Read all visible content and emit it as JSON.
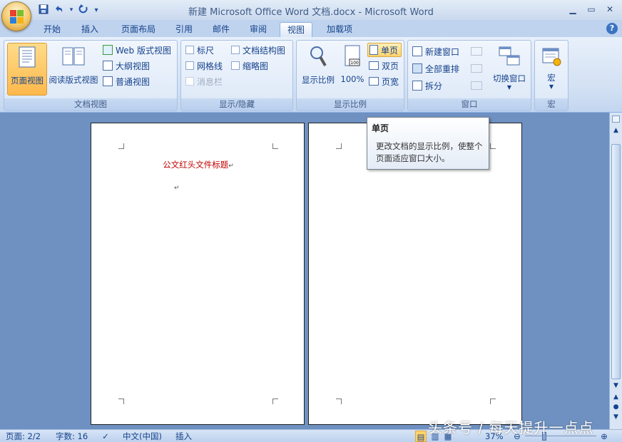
{
  "window": {
    "title": "新建 Microsoft Office Word 文档.docx - Microsoft Word"
  },
  "quick_access": {
    "save": "save-icon",
    "undo": "undo-icon",
    "redo": "redo-icon",
    "customize": "▾"
  },
  "tabs": [
    "开始",
    "插入",
    "页面布局",
    "引用",
    "邮件",
    "审阅",
    "视图",
    "加载项"
  ],
  "active_tab": "视图",
  "ribbon": {
    "doc_view": {
      "label": "文档视图",
      "page_view": "页面视图",
      "read_view": "阅读版式视图",
      "web_view": "Web 版式视图",
      "outline_view": "大纲视图",
      "draft_view": "普通视图"
    },
    "show_hide": {
      "label": "显示/隐藏",
      "ruler": "标尺",
      "gridlines": "网格线",
      "message_bar": "消息栏",
      "doc_map": "文档结构图",
      "thumbnails": "缩略图"
    },
    "zoom": {
      "label": "显示比例",
      "zoom": "显示比例",
      "hundred": "100%",
      "one_page": "单页",
      "two_pages": "双页",
      "page_width": "页宽"
    },
    "window": {
      "label": "窗口",
      "new_window": "新建窗口",
      "arrange_all": "全部重排",
      "split": "拆分",
      "switch_windows": "切换窗口"
    },
    "macros": {
      "label": "宏",
      "macros": "宏"
    }
  },
  "tooltip": {
    "title": "单页",
    "body": "更改文档的显示比例，使整个页面适应窗口大小。"
  },
  "document": {
    "heading": "公文红头文件标题",
    "para_mark": "↵"
  },
  "status": {
    "page": "页面: 2/2",
    "words": "字数: 16",
    "language": "中文(中国)",
    "mode": "插入",
    "zoom": "37%"
  },
  "watermark": "头条号 / 每天提升一点点",
  "colors": {
    "heading_red": "#c00000",
    "accent_orange": "#ffb84b"
  }
}
